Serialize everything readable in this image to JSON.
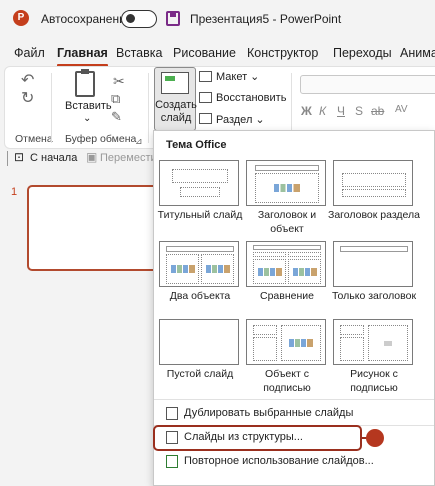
{
  "titlebar": {
    "app_logo": "P",
    "autosave_label": "Автосохранение",
    "autosave_state": "off",
    "document_title": "Презентация5  -  PowerPoint"
  },
  "menu": {
    "tabs": [
      "Файл",
      "Главная",
      "Вставка",
      "Рисование",
      "Конструктор",
      "Переходы",
      "Анима"
    ],
    "active_tab": "Главная"
  },
  "ribbon": {
    "undo_group_label": "Отмена",
    "clipboard": {
      "paste_label": "Вставить",
      "paste_chevron": "⌄",
      "group_label": "Буфер обмена"
    },
    "slides": {
      "create_line1": "Создать",
      "create_line2": "слайд ⌄",
      "layout_label": "Макет ⌄",
      "reset_label": "Восстановить",
      "section_label": "Раздел ⌄"
    },
    "format_letters": [
      "Ж",
      "К",
      "Ч",
      "S",
      "ab",
      "AV"
    ]
  },
  "quickbar": {
    "from_start": "С начала",
    "move": "Переместит"
  },
  "slides_panel": {
    "slide_number": "1"
  },
  "dropdown": {
    "heading": "Тема Office",
    "layouts": [
      {
        "label": "Титульный слайд"
      },
      {
        "label": "Заголовок и объект"
      },
      {
        "label": "Заголовок раздела"
      },
      {
        "label": "Два объекта"
      },
      {
        "label": "Сравнение"
      },
      {
        "label": "Только заголовок"
      },
      {
        "label": "Пустой слайд"
      },
      {
        "label": "Объект с подписью"
      },
      {
        "label": "Рисунок с подписью"
      }
    ],
    "commands": {
      "duplicate": "Дублировать выбранные слайды",
      "from_outline": "Слайды из структуры...",
      "reuse": "Повторное использование слайдов..."
    }
  },
  "colors": {
    "accent": "#c43e1c",
    "highlight": "#9a2f1e"
  }
}
